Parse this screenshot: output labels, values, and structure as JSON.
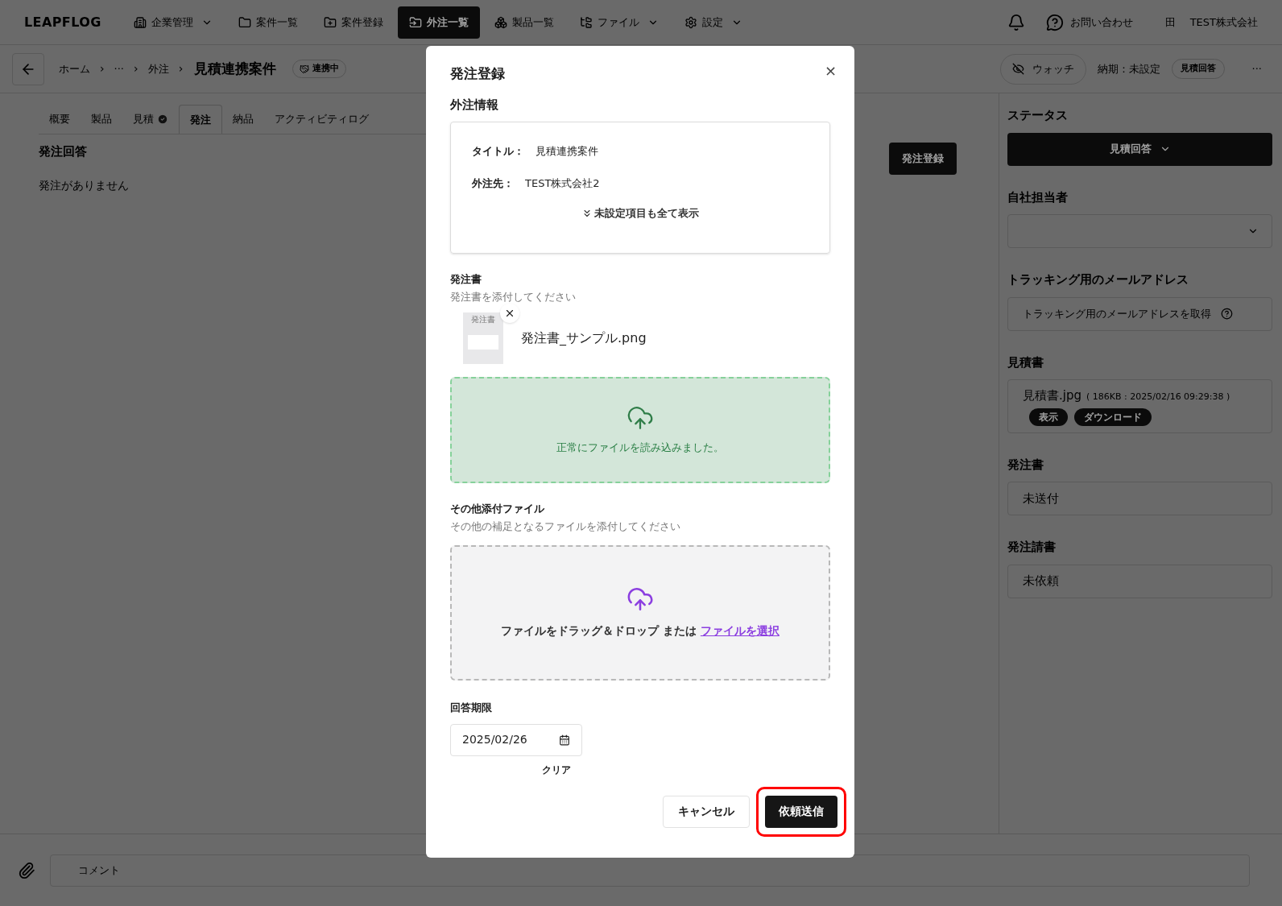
{
  "nav": {
    "logo": "LEAPFLOG",
    "items": [
      {
        "label": "企業管理",
        "selected": false,
        "dropdown": true
      },
      {
        "label": "案件一覧",
        "selected": false,
        "dropdown": false
      },
      {
        "label": "案件登録",
        "selected": false,
        "dropdown": false
      },
      {
        "label": "外注一覧",
        "selected": true,
        "dropdown": false
      },
      {
        "label": "製品一覧",
        "selected": false,
        "dropdown": false
      },
      {
        "label": "ファイル",
        "selected": false,
        "dropdown": true
      },
      {
        "label": "設定",
        "selected": false,
        "dropdown": true
      }
    ],
    "contact": "お問い合わせ",
    "company_icon": "田",
    "company": "TEST株式会社"
  },
  "breadcrumb": {
    "items": [
      "ホーム",
      "···",
      "外注"
    ],
    "separator": "›",
    "title": "見積連携案件",
    "badge": "連携中"
  },
  "header_right": {
    "watch": "ウォッチ",
    "due": "納期：未設定",
    "status_badge": "見積回答",
    "more": "···"
  },
  "tabs": [
    {
      "label": "概要",
      "selected": false,
      "checked": false
    },
    {
      "label": "製品",
      "selected": false,
      "checked": false
    },
    {
      "label": "見積",
      "selected": false,
      "checked": true
    },
    {
      "label": "発注",
      "selected": true,
      "checked": false
    },
    {
      "label": "納品",
      "selected": false,
      "checked": false
    },
    {
      "label": "アクティビティログ",
      "selected": false,
      "checked": false
    }
  ],
  "content": {
    "heading": "発注回答",
    "empty": "発注がありません",
    "register_button": "発注登録"
  },
  "sidebar": {
    "status_label": "ステータス",
    "status_value": "見積回答",
    "assignee_label": "自社担当者",
    "tracking_label": "トラッキング用のメールアドレス",
    "tracking_button": "トラッキング用のメールアドレスを取得",
    "quote_label": "見積書",
    "quote_file": "見積書.jpg",
    "quote_meta": "( 186KB : 2025/02/16 09:29:38 )",
    "quote_actions": [
      "表示",
      "ダウンロード"
    ],
    "po_label": "発注書",
    "po_value": "未送付",
    "ack_label": "発注請書",
    "ack_value": "未依頼"
  },
  "comment": {
    "placeholder": "コメント"
  },
  "modal": {
    "title": "発注登録",
    "close": "×",
    "section": "外注情報",
    "info": [
      {
        "label": "タイトル：",
        "value": "見積連携案件"
      },
      {
        "label": "外注先：",
        "value": "TEST株式会社2"
      }
    ],
    "show_all": "未設定項目も全て表示",
    "po": {
      "label": "発注書",
      "hint": "発注書を添付してください",
      "thumb_text": "発注書",
      "file": "発注書_サンプル.png",
      "drop_message": "正常にファイルを読み込みました。"
    },
    "other": {
      "label": "その他添付ファイル",
      "hint": "その他の補足となるファイルを添付してください",
      "drop_text": "ファイルをドラッグ＆ドロップ または",
      "drop_link": "ファイルを選択"
    },
    "deadline": {
      "label": "回答期限",
      "value": "2025/02/26",
      "clear": "クリア"
    },
    "cancel": "キャンセル",
    "submit": "依頼送信",
    "submit_highlighted": true
  }
}
